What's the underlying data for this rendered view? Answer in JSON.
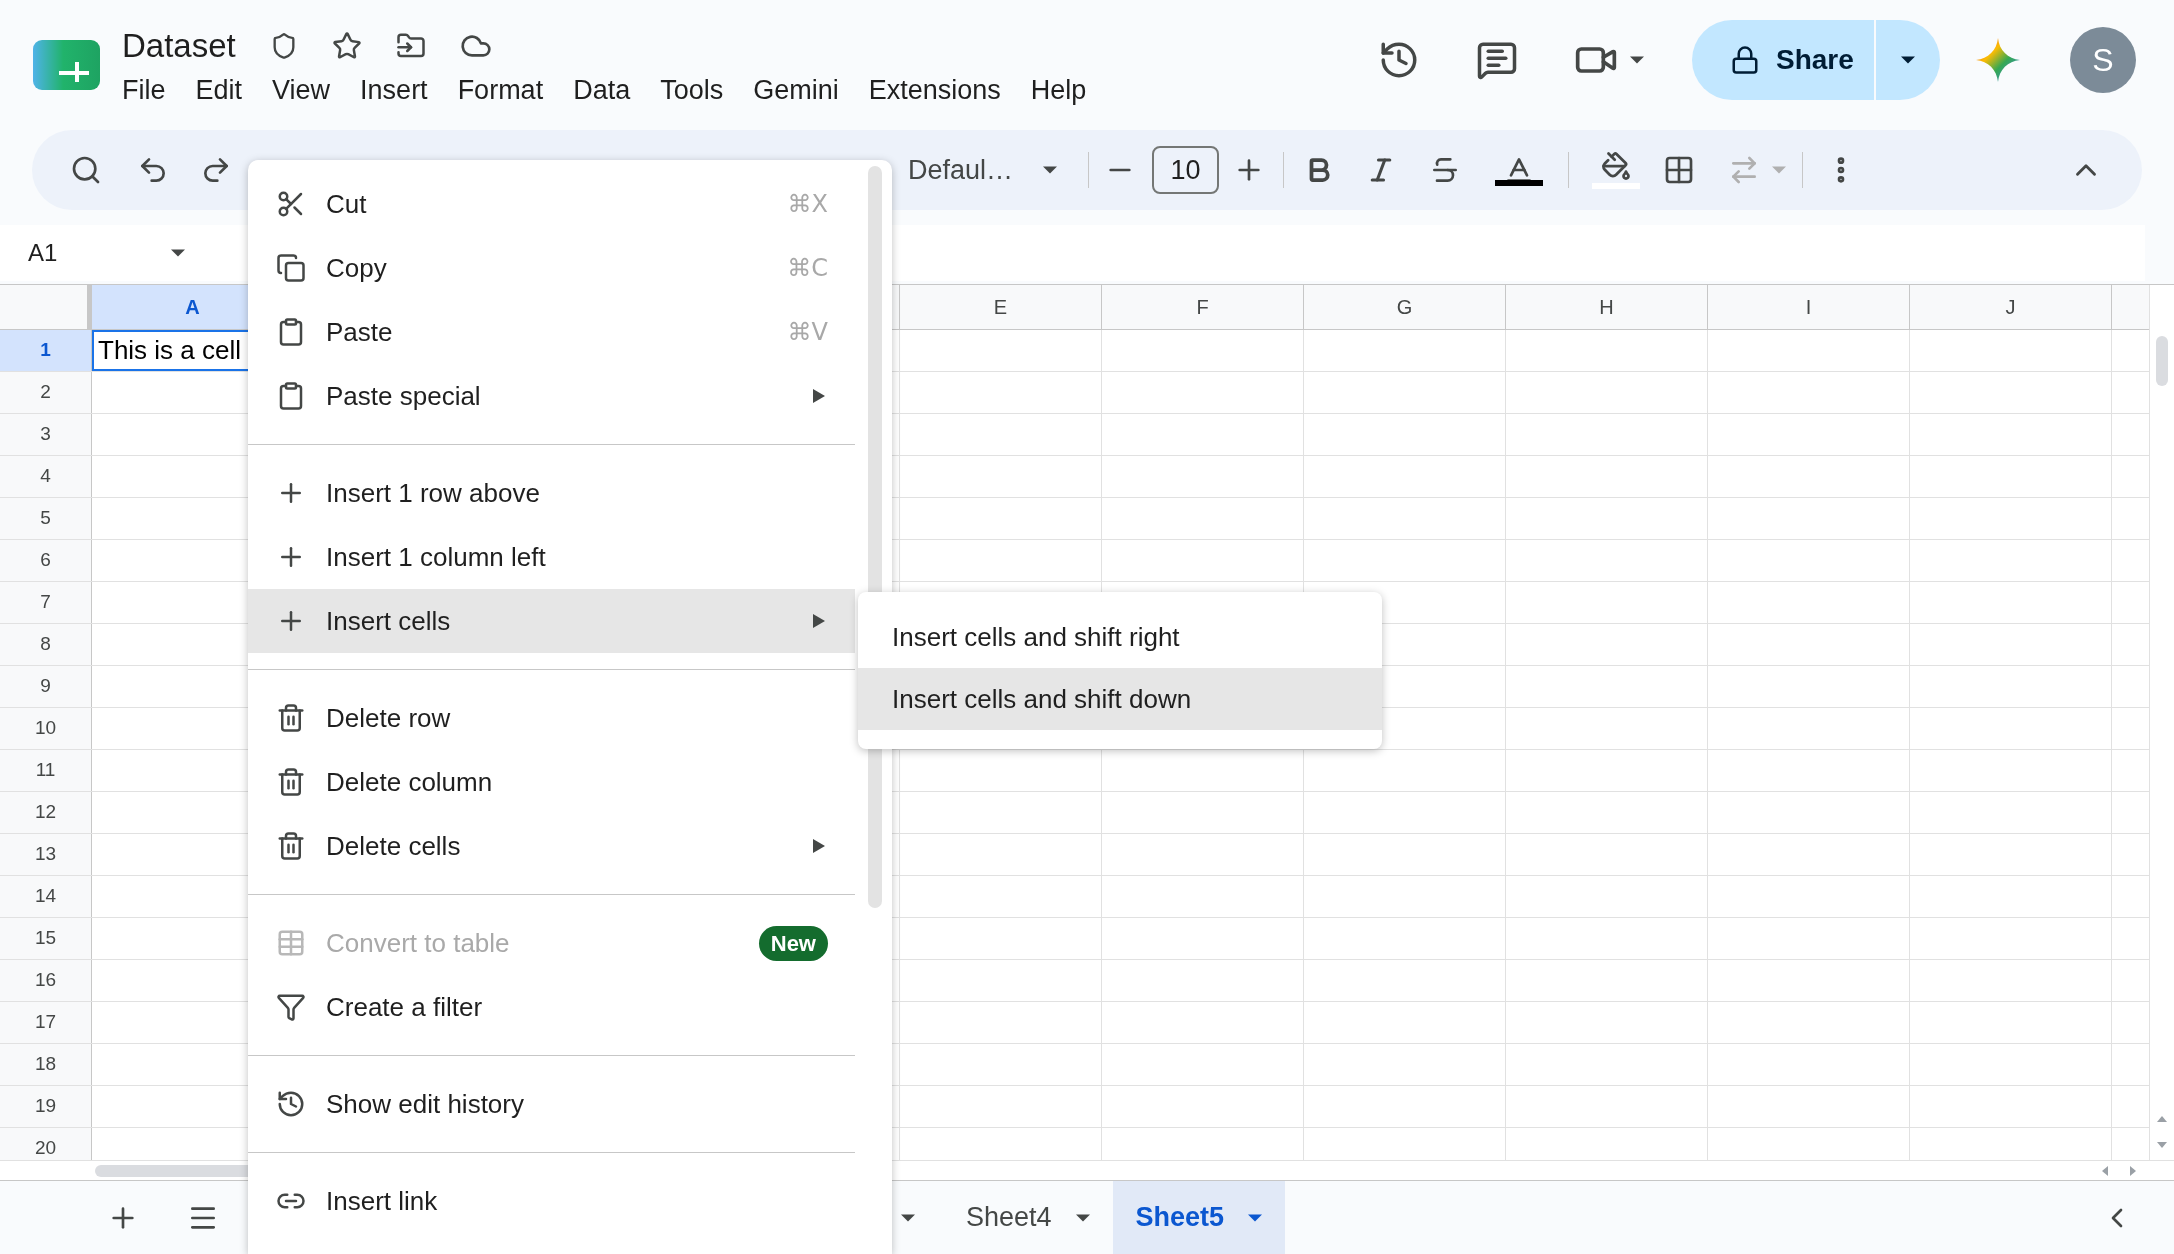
{
  "document": {
    "title": "Dataset"
  },
  "menu_bar": [
    "File",
    "Edit",
    "View",
    "Insert",
    "Format",
    "Data",
    "Tools",
    "Gemini",
    "Extensions",
    "Help"
  ],
  "share_button": {
    "label": "Share"
  },
  "account": {
    "initial": "S"
  },
  "toolbar": {
    "font": "Defaul…",
    "font_size": "10"
  },
  "name_box": {
    "value": "A1"
  },
  "sheet": {
    "columns": [
      {
        "label": "A",
        "selected": true
      },
      {
        "label": "E",
        "selected": false
      },
      {
        "label": "F",
        "selected": false
      },
      {
        "label": "G",
        "selected": false
      },
      {
        "label": "H",
        "selected": false
      },
      {
        "label": "I",
        "selected": false
      },
      {
        "label": "J",
        "selected": false
      }
    ],
    "rows": [
      {
        "label": "1",
        "selected": true,
        "cells": [
          "This is a cell"
        ]
      },
      {
        "label": "2",
        "selected": false
      },
      {
        "label": "3",
        "selected": false
      },
      {
        "label": "4",
        "selected": false
      },
      {
        "label": "5",
        "selected": false
      },
      {
        "label": "6",
        "selected": false
      },
      {
        "label": "7",
        "selected": false
      },
      {
        "label": "8",
        "selected": false
      },
      {
        "label": "9",
        "selected": false
      },
      {
        "label": "10",
        "selected": false
      },
      {
        "label": "11",
        "selected": false
      },
      {
        "label": "12",
        "selected": false
      },
      {
        "label": "13",
        "selected": false
      },
      {
        "label": "14",
        "selected": false
      },
      {
        "label": "15",
        "selected": false
      },
      {
        "label": "16",
        "selected": false
      },
      {
        "label": "17",
        "selected": false
      },
      {
        "label": "18",
        "selected": false
      },
      {
        "label": "19",
        "selected": false
      },
      {
        "label": "20",
        "selected": false
      }
    ]
  },
  "context_menu": {
    "items": [
      {
        "kind": "cut",
        "label": "Cut",
        "shortcut": "⌘X",
        "submenu": false,
        "selected": false,
        "disabled": false
      },
      {
        "kind": "copy",
        "label": "Copy",
        "shortcut": "⌘C",
        "submenu": false,
        "selected": false,
        "disabled": false
      },
      {
        "kind": "paste",
        "label": "Paste",
        "shortcut": "⌘V",
        "submenu": false,
        "selected": false,
        "disabled": false
      },
      {
        "kind": "paste",
        "label": "Paste special",
        "submenu": true,
        "selected": false,
        "disabled": false
      },
      {
        "kind": "separator"
      },
      {
        "kind": "insert",
        "label": "Insert 1 row above",
        "submenu": false,
        "selected": false,
        "disabled": false
      },
      {
        "kind": "insert",
        "label": "Insert 1 column left",
        "submenu": false,
        "selected": false,
        "disabled": false
      },
      {
        "kind": "insert",
        "label": "Insert cells",
        "submenu": true,
        "selected": true,
        "disabled": false
      },
      {
        "kind": "separator"
      },
      {
        "kind": "delete",
        "label": "Delete row",
        "submenu": false,
        "selected": false,
        "disabled": false
      },
      {
        "kind": "delete",
        "label": "Delete column",
        "submenu": false,
        "selected": false,
        "disabled": false
      },
      {
        "kind": "delete",
        "label": "Delete cells",
        "submenu": true,
        "selected": false,
        "disabled": false
      },
      {
        "kind": "separator"
      },
      {
        "kind": "table",
        "label": "Convert to table",
        "badge": "New",
        "submenu": false,
        "selected": false,
        "disabled": true
      },
      {
        "kind": "filter",
        "label": "Create a filter",
        "submenu": false,
        "selected": false,
        "disabled": false
      },
      {
        "kind": "separator"
      },
      {
        "kind": "history",
        "label": "Show edit history",
        "submenu": false,
        "selected": false,
        "disabled": false
      },
      {
        "kind": "separator"
      },
      {
        "kind": "link",
        "label": "Insert link",
        "submenu": false,
        "selected": false,
        "disabled": false
      }
    ]
  },
  "submenu": {
    "items": [
      {
        "label": "Insert cells and shift right",
        "selected": false
      },
      {
        "label": "Insert cells and shift down",
        "selected": true
      }
    ]
  },
  "sheet_tabs": [
    {
      "label": "Sheet4",
      "selected": false
    },
    {
      "label": "Sheet5",
      "selected": true
    }
  ]
}
